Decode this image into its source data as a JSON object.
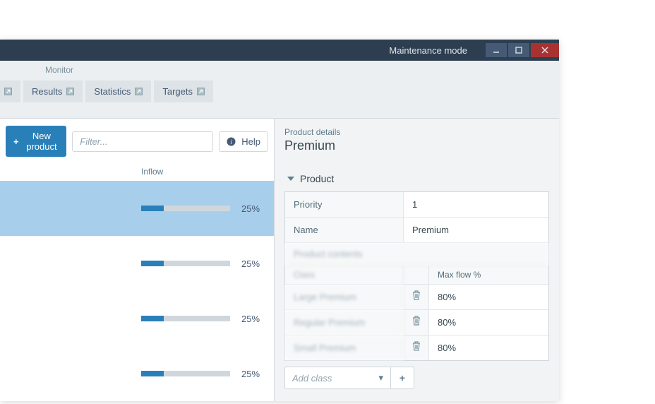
{
  "titlebar": {
    "mode": "Maintenance mode"
  },
  "ribbon": {
    "group": "Monitor",
    "tabs": [
      "Results",
      "Statistics",
      "Targets"
    ]
  },
  "toolbar": {
    "new_product": "New product",
    "filter_placeholder": "Filter...",
    "help": "Help"
  },
  "list": {
    "header": "Inflow",
    "rows": [
      {
        "pct": 25,
        "label": "25%",
        "selected": true
      },
      {
        "pct": 25,
        "label": "25%",
        "selected": false
      },
      {
        "pct": 25,
        "label": "25%",
        "selected": false
      },
      {
        "pct": 25,
        "label": "25%",
        "selected": false
      }
    ]
  },
  "details": {
    "label": "Product details",
    "name": "Premium",
    "section": "Product",
    "priority_label": "Priority",
    "priority_value": "1",
    "name_label": "Name",
    "name_value": "Premium",
    "contents_header": "Product contents",
    "col_class": "Class",
    "col_maxflow": "Max flow %",
    "classes": [
      {
        "name": "Large Premium",
        "flow": "80%"
      },
      {
        "name": "Regular Premium",
        "flow": "80%"
      },
      {
        "name": "Small Premium",
        "flow": "80%"
      }
    ],
    "add_placeholder": "Add class"
  }
}
